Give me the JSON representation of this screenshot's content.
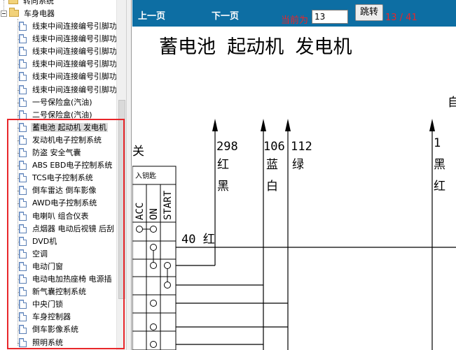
{
  "tree": {
    "top_items": [
      {
        "label": "转向系统",
        "type": "folder"
      },
      {
        "label": "车身电器",
        "type": "folder"
      }
    ],
    "items": [
      {
        "label": "线束中间连接编号引脚功"
      },
      {
        "label": "线束中间连接编号引脚功"
      },
      {
        "label": "线束中间连接编号引脚功"
      },
      {
        "label": "线束中间连接编号引脚功"
      },
      {
        "label": "线束中间连接编号引脚功"
      },
      {
        "label": "线束中间连接编号引脚功"
      },
      {
        "label": "一号保险盒(汽油)"
      },
      {
        "label": "二号保险盒(汽油)"
      },
      {
        "label": "蓄电池 起动机 发电机",
        "selected": true
      },
      {
        "label": "发动机电子控制系统"
      },
      {
        "label": "防盗 安全气囊"
      },
      {
        "label": "ABS EBD电子控制系统"
      },
      {
        "label": "TCS电子控制系统"
      },
      {
        "label": "倒车雷达 倒车影像"
      },
      {
        "label": "AWD电子控制系统"
      },
      {
        "label": "电喇叭 组合仪表"
      },
      {
        "label": "点烟器 电动后视镜 后刮"
      },
      {
        "label": "DVD机"
      },
      {
        "label": "空调"
      },
      {
        "label": "电动门窗"
      },
      {
        "label": "电动电加热座椅 电源插"
      },
      {
        "label": "新气囊控制系统"
      },
      {
        "label": "中央门锁"
      },
      {
        "label": "车身控制器"
      },
      {
        "label": "倒车影像系统"
      },
      {
        "label": "照明系统"
      }
    ]
  },
  "toolbar": {
    "prev_label": "上一页",
    "next_label": "下一页",
    "current_label": "当前为",
    "page_value": "13",
    "jump_label": "跳转",
    "page_count": "13 / 41"
  },
  "diagram": {
    "title": "蓄电池 起动机 发电机",
    "corner_text": "自",
    "left_text": "关",
    "key_label": "入钥匙",
    "switch_positions": [
      "ACC",
      "ON",
      "START"
    ],
    "wires": [
      {
        "number": "298",
        "color1": "红",
        "color2": "黑"
      },
      {
        "number": "106",
        "color1": "蓝",
        "color2": "白"
      },
      {
        "number": "112",
        "color1": "绿",
        "color2": ""
      },
      {
        "number": "1",
        "color1": "黑",
        "color2": "红"
      }
    ],
    "horizontal_wire_label": "40 红"
  },
  "colors": {
    "toolbar_bg": "#0d6ea3",
    "counter_red": "#e8262a",
    "highlight_border": "#e8262a"
  }
}
